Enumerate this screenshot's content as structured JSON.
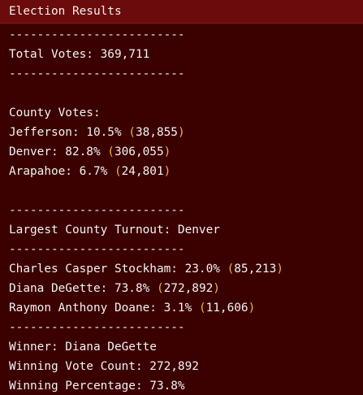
{
  "title": "Election Results",
  "separator": "-------------------------",
  "total_votes": "Total Votes: 369,711",
  "county_header": "County Votes:",
  "counties": [
    {
      "label": "Jefferson: 10.5% ",
      "open": "(",
      "count": "38,855",
      "close": ")"
    },
    {
      "label": "Denver: 82.8% ",
      "open": "(",
      "count": "306,055",
      "close": ")"
    },
    {
      "label": "Arapahoe: 6.7% ",
      "open": "(",
      "count": "24,801",
      "close": ")"
    }
  ],
  "largest_county": "Largest County Turnout: Denver",
  "candidates": [
    {
      "label": "Charles Casper Stockham: 23.0% ",
      "open": "(",
      "count": "85,213",
      "close": ")"
    },
    {
      "label": "Diana DeGette: 73.8% ",
      "open": "(",
      "count": "272,892",
      "close": ")"
    },
    {
      "label": "Raymon Anthony Doane: 3.1% ",
      "open": "(",
      "count": "11,606",
      "close": ")"
    }
  ],
  "winner": "Winner: Diana DeGette",
  "winning_vote_count": "Winning Vote Count: 272,892",
  "winning_percentage": "Winning Percentage: 73.8%",
  "colors": {
    "background": "#3b0000",
    "title_bar": "#6b0b0b",
    "text": "#f2f2f2",
    "parenthesis": "#e8b84b"
  }
}
